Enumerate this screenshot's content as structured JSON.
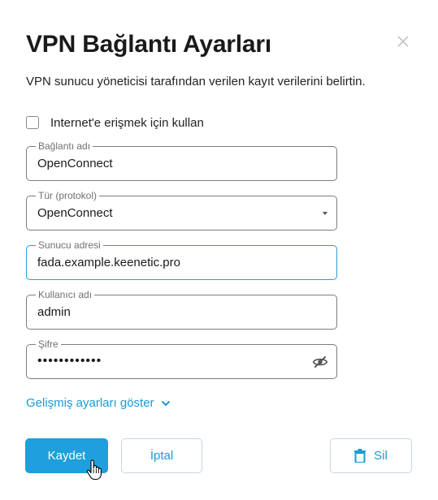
{
  "dialog": {
    "title": "VPN Bağlantı Ayarları",
    "subtitle": "VPN sunucu yöneticisi tarafından verilen kayıt verilerini belirtin.",
    "close_icon": "close-icon"
  },
  "internet_checkbox": {
    "label": "Internet'e erişmek için kullan",
    "checked": false
  },
  "fields": {
    "connection_name": {
      "label": "Bağlantı adı",
      "value": "OpenConnect"
    },
    "protocol": {
      "label": "Tür (protokol)",
      "value": "OpenConnect"
    },
    "server_address": {
      "label": "Sunucu adresi",
      "value": "fada.example.keenetic.pro"
    },
    "username": {
      "label": "Kullanıcı adı",
      "value": "admin"
    },
    "password": {
      "label": "Şifre",
      "value": "••••••••••••"
    }
  },
  "advanced_link": {
    "label": "Gelişmiş ayarları göster"
  },
  "buttons": {
    "save": "Kaydet",
    "cancel": "İptal",
    "delete": "Sil"
  },
  "colors": {
    "accent": "#1f9fdb",
    "focus_border": "#2a9fd6",
    "border": "#7d7d7d"
  }
}
